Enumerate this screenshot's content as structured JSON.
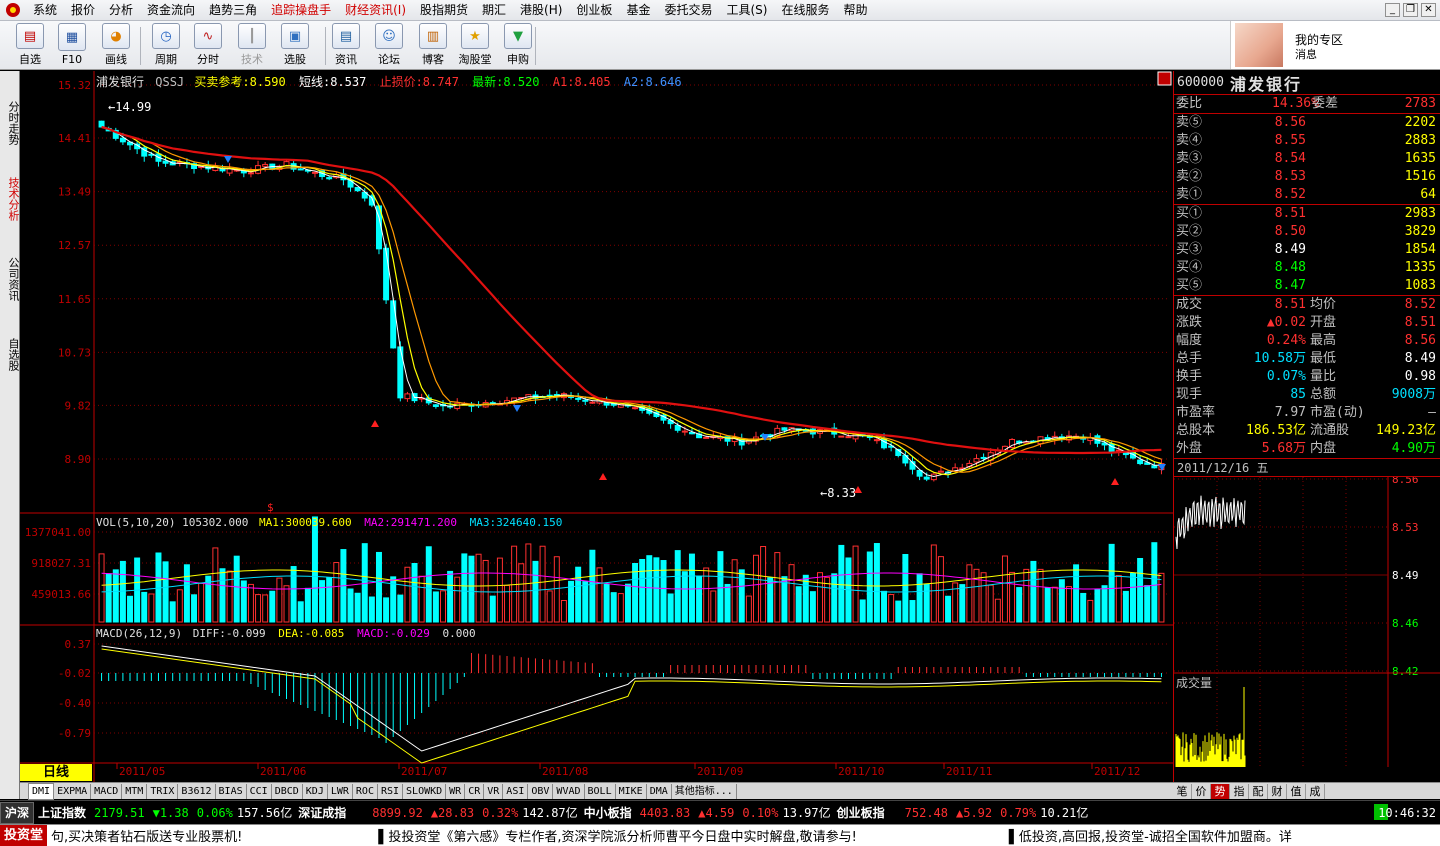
{
  "menu": [
    "系统",
    "报价",
    "分析",
    "资金流向",
    "趋势三角",
    "追踪操盘手",
    "财经资讯(I)",
    "股指期货",
    "期汇",
    "港股(H)",
    "创业板",
    "基金",
    "委托交易",
    "工具(S)",
    "在线服务",
    "帮助"
  ],
  "menu_red": [
    5,
    6
  ],
  "toolbar": [
    {
      "label": "自选",
      "icon": "watchlist-icon",
      "sym": "▤"
    },
    {
      "label": "F10",
      "icon": "f10-icon",
      "sym": "▦"
    },
    {
      "label": "画线",
      "icon": "draw-line-icon",
      "sym": "◕"
    },
    {
      "label": "周期",
      "icon": "period-icon",
      "sym": "◷"
    },
    {
      "label": "分时",
      "icon": "intraday-icon",
      "sym": "∿"
    },
    {
      "label": "技术",
      "icon": "technical-icon",
      "sym": "┃"
    },
    {
      "label": "选股",
      "icon": "stock-picker-icon",
      "sym": "▣"
    },
    {
      "label": "资讯",
      "icon": "news-icon",
      "sym": "▤"
    },
    {
      "label": "论坛",
      "icon": "forum-icon",
      "sym": "☺"
    },
    {
      "label": "博客",
      "icon": "blog-icon",
      "sym": "▥"
    },
    {
      "label": "淘股堂",
      "icon": "taogutang-icon",
      "sym": "★"
    },
    {
      "label": "申购",
      "icon": "subscribe-icon",
      "sym": "▼"
    }
  ],
  "promo": {
    "title": "我的专区",
    "subtitle": "消息"
  },
  "side_tabs": [
    "分时走势",
    "技术分析",
    "公司资讯",
    "自选股"
  ],
  "stock": {
    "code": "600000",
    "name": "浦发银行"
  },
  "main_info": {
    "name": "浦发银行",
    "formula": "QSSJ",
    "buy_ref": "买卖参考:8.590",
    "short": "短线:8.537",
    "stop": "止损价:8.747",
    "latest": "最新:8.520",
    "a1": "A1:8.405",
    "a2": "A2:8.646"
  },
  "price_axis": [
    "15.32",
    "14.41",
    "13.49",
    "12.57",
    "11.65",
    "10.73",
    "9.82",
    "8.90"
  ],
  "vol_axis": [
    "1377041.00",
    "918027.31",
    "459013.66"
  ],
  "macd_axis": [
    "0.37",
    "-0.02",
    "-0.40",
    "-0.79"
  ],
  "vol_info": {
    "name": "VOL(5,10,20) 105302.000",
    "ma1": "MA1:300039.600",
    "ma2": "MA2:291471.200",
    "ma3": "MA3:324640.150"
  },
  "macd_info": {
    "name": "MACD(26,12,9)",
    "diff": "DIFF:-0.099",
    "dea": "DEA:-0.085",
    "macd": "MACD:-0.029",
    "last": "0.000"
  },
  "price_labels": {
    "high": "14.99",
    "low": "8.33"
  },
  "date_axis": [
    "2011/05",
    "2011/06",
    "2011/07",
    "2011/08",
    "2011/09",
    "2011/10",
    "2011/11",
    "2011/12"
  ],
  "period_tab": "日线",
  "indicator_tabs": [
    "DMI",
    "EXPMA",
    "MACD",
    "MTM",
    "TRIX",
    "B3612",
    "BIAS",
    "CCI",
    "DBCD",
    "KDJ",
    "LWR",
    "ROC",
    "RSI",
    "SLOWKD",
    "WR",
    "CR",
    "VR",
    "ASI",
    "OBV",
    "WVAD",
    "BOLL",
    "MIKE",
    "DMA",
    "其他指标..."
  ],
  "quote": {
    "weibi": {
      "label": "委比",
      "val": "14.36%",
      "label2": "委差",
      "val2": "2783"
    },
    "sell": [
      {
        "l": "卖⑤",
        "p": "8.56",
        "v": "2202"
      },
      {
        "l": "卖④",
        "p": "8.55",
        "v": "2883"
      },
      {
        "l": "卖③",
        "p": "8.54",
        "v": "1635"
      },
      {
        "l": "卖②",
        "p": "8.53",
        "v": "1516"
      },
      {
        "l": "卖①",
        "p": "8.52",
        "v": "64"
      }
    ],
    "buy": [
      {
        "l": "买①",
        "p": "8.51",
        "v": "2983"
      },
      {
        "l": "买②",
        "p": "8.50",
        "v": "3829"
      },
      {
        "l": "买③",
        "p": "8.49",
        "v": "1854"
      },
      {
        "l": "买④",
        "p": "8.48",
        "v": "1335"
      },
      {
        "l": "买⑤",
        "p": "8.47",
        "v": "1083"
      }
    ],
    "stats": [
      {
        "l1": "成交",
        "v1": "8.51",
        "l2": "均价",
        "v2": "8.52"
      },
      {
        "l1": "涨跌",
        "v1": "▲0.02",
        "l2": "开盘",
        "v2": "8.51"
      },
      {
        "l1": "幅度",
        "v1": "0.24%",
        "l2": "最高",
        "v2": "8.56"
      },
      {
        "l1": "总手",
        "v1": "10.58万",
        "l2": "最低",
        "v2": "8.49"
      },
      {
        "l1": "换手",
        "v1": "0.07%",
        "l2": "量比",
        "v2": "0.98"
      },
      {
        "l1": "现手",
        "v1": "85",
        "l2": "总额",
        "v2": "9008万"
      },
      {
        "l1": "市盈率",
        "v1": "7.97",
        "l2": "市盈(动)",
        "v2": "—"
      },
      {
        "l1": "总股本",
        "v1": "186.53亿",
        "l2": "流通股",
        "v2": "149.23亿"
      },
      {
        "l1": "外盘",
        "v1": "5.68万",
        "l2": "内盘",
        "v2": "4.90万"
      }
    ]
  },
  "mini": {
    "date": "2011/12/16 五",
    "axis": [
      "8.56",
      "8.53",
      "8.49",
      "8.46",
      "8.42"
    ],
    "vol_label": "成交量"
  },
  "right_tabs": [
    "笔",
    "价",
    "势",
    "指",
    "配",
    "财",
    "值",
    "成"
  ],
  "status": {
    "market": "沪深",
    "sh": {
      "name": "上证指数",
      "val": "2179.51",
      "chg": "▼1.38",
      "pct": "0.06%",
      "amt": "157.56亿"
    },
    "sz": {
      "name": "深证成指",
      "val": "8899.92",
      "chg": "▲28.83",
      "pct": "0.32%",
      "amt": "142.87亿"
    },
    "zx": {
      "name": "中小板指",
      "val": "4403.83",
      "chg": "▲4.59",
      "pct": "0.10%",
      "amt": "13.97亿"
    },
    "cy": {
      "name": "创业板指",
      "val": "752.48",
      "chg": "▲5.92",
      "pct": "0.79%",
      "amt": "10.21亿"
    },
    "time": "10:46:32"
  },
  "ticker": {
    "logo": "投资堂",
    "t1": "句,买决策者钻石版送专业股票机!",
    "t2": "▌投投资堂《第六感》专栏作者,资深学院派分析师曹平今日盘中实时解盘,敬请参与!",
    "t3": "▌低投资,高回报,投资堂-诚招全国软件加盟商。详"
  }
}
